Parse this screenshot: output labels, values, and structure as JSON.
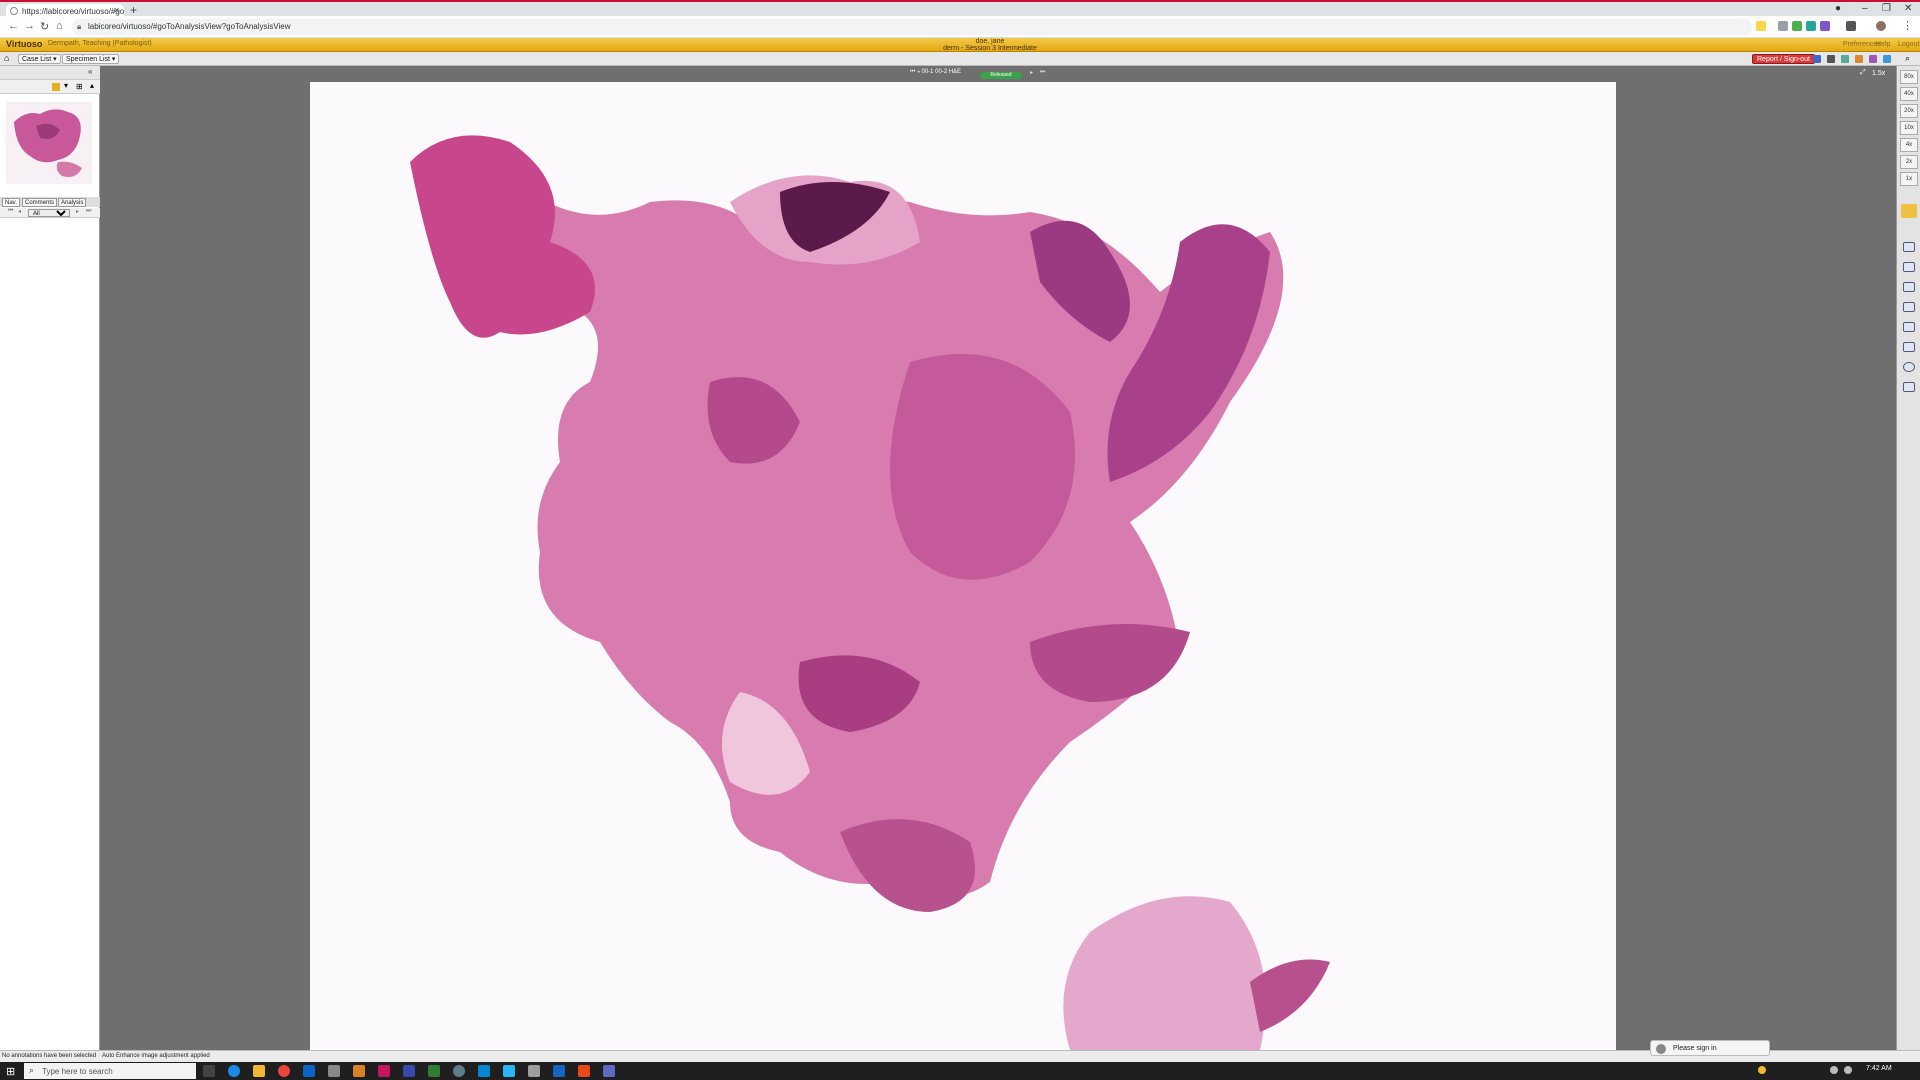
{
  "browser": {
    "tab_title": "https://labicoreo/virtuoso/#goTo",
    "new_tab_symbol": "+",
    "url": "labicoreo/virtuoso/#goToAnalysisView?goToAnalysisView"
  },
  "app": {
    "title": "Virtuoso",
    "subtitle": "Dermpath, Teaching (Pathologist)",
    "user_name": "doe, jane",
    "session": "derm - Session 3 Intermediate",
    "links": [
      "Preferences",
      "Help",
      "Logout"
    ]
  },
  "menubar": {
    "case_list": "Case List",
    "specimen_list": "Specimen List",
    "report_signout": "Report / Sign-out"
  },
  "left_panel": {
    "tabs": [
      "Nav.",
      "Comments",
      "Analysis"
    ],
    "filter_value": "All"
  },
  "viewer": {
    "slide_label": "00-1 00-2 H&E",
    "status": "Released",
    "zoom_readout": "1.5x"
  },
  "zoom_levels": [
    "80x",
    "40x",
    "20x",
    "10x",
    "4x",
    "2x",
    "1x"
  ],
  "statusbar": {
    "left": "No annotations have been selected",
    "right": "Auto Enhance image adjustment applied"
  },
  "signin_prompt": "Please sign in",
  "taskbar": {
    "search_placeholder": "Type here to search",
    "clock": "7:42 AM"
  },
  "colors": {
    "app_header": "#e3a914",
    "report_button": "#d83a3a",
    "released_badge": "#3aa24a",
    "tissue_main": "#c0508f"
  }
}
